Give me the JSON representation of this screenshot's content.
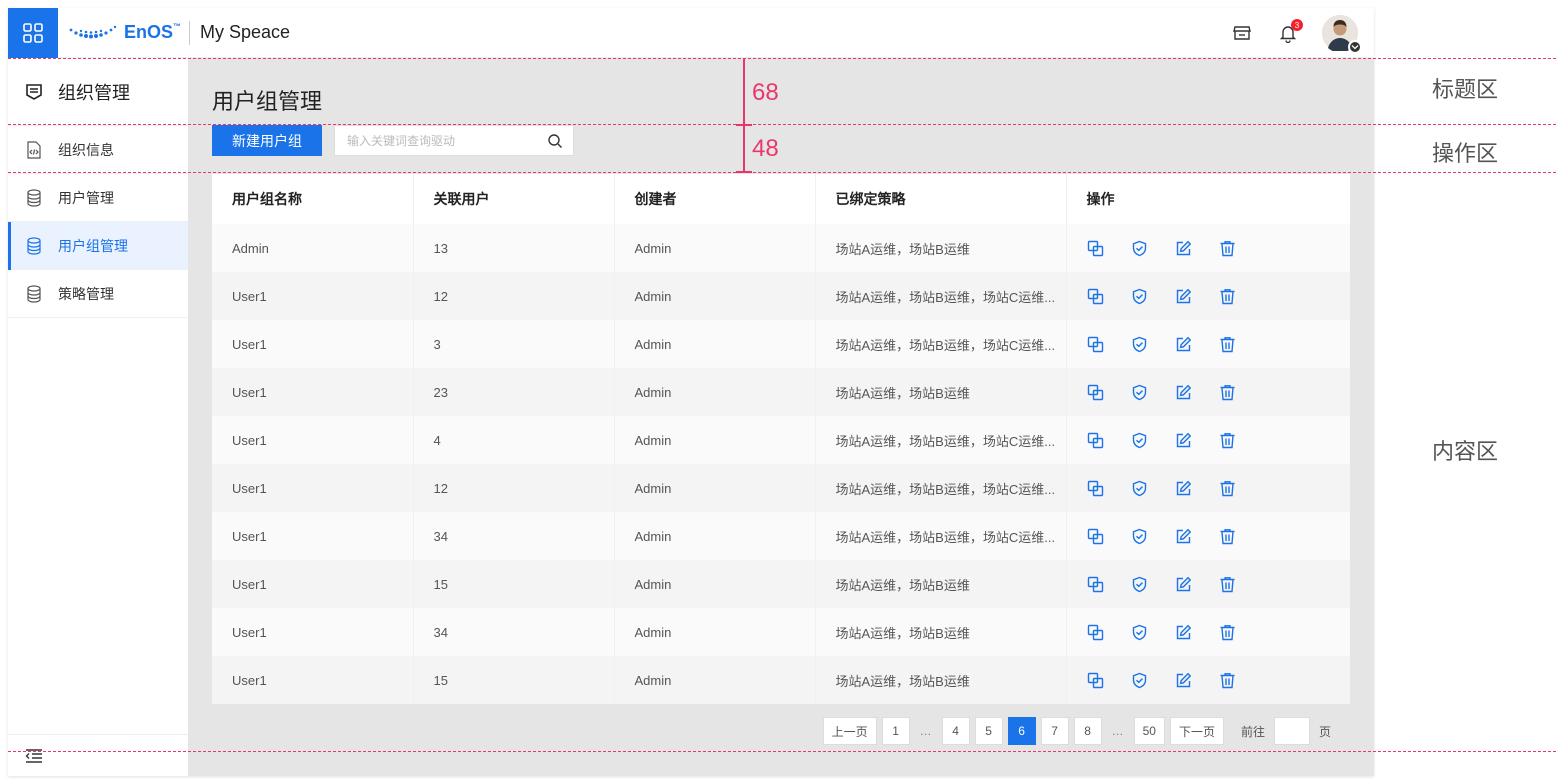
{
  "topbar": {
    "brand": "EnOS",
    "brand_tm": "™",
    "workspace": "My Speace",
    "notification_count": "3"
  },
  "sidebar": {
    "title": "组织管理",
    "items": [
      {
        "label": "组织信息",
        "icon": "document-code-icon",
        "active": false
      },
      {
        "label": "用户管理",
        "icon": "database-icon",
        "active": false
      },
      {
        "label": "用户组管理",
        "icon": "database-icon",
        "active": true
      },
      {
        "label": "策略管理",
        "icon": "database-icon",
        "active": false
      }
    ]
  },
  "main": {
    "page_title": "用户组管理",
    "new_button": "新建用户组",
    "search_placeholder": "输入关键词查询驱动"
  },
  "table": {
    "columns": [
      "用户组名称",
      "关联用户",
      "创建者",
      "已绑定策略",
      "操作"
    ],
    "rows": [
      {
        "name": "Admin",
        "users": "13",
        "creator": "Admin",
        "policy": "场站A运维，场站B运维"
      },
      {
        "name": "User1",
        "users": "12",
        "creator": "Admin",
        "policy": "场站A运维，场站B运维，场站C运维..."
      },
      {
        "name": "User1",
        "users": "3",
        "creator": "Admin",
        "policy": "场站A运维，场站B运维，场站C运维..."
      },
      {
        "name": "User1",
        "users": "23",
        "creator": "Admin",
        "policy": "场站A运维，场站B运维"
      },
      {
        "name": "User1",
        "users": "4",
        "creator": "Admin",
        "policy": "场站A运维，场站B运维，场站C运维..."
      },
      {
        "name": "User1",
        "users": "12",
        "creator": "Admin",
        "policy": "场站A运维，场站B运维，场站C运维..."
      },
      {
        "name": "User1",
        "users": "34",
        "creator": "Admin",
        "policy": "场站A运维，场站B运维，场站C运维..."
      },
      {
        "name": "User1",
        "users": "15",
        "creator": "Admin",
        "policy": "场站A运维，场站B运维"
      },
      {
        "name": "User1",
        "users": "34",
        "creator": "Admin",
        "policy": "场站A运维，场站B运维"
      },
      {
        "name": "User1",
        "users": "15",
        "creator": "Admin",
        "policy": "场站A运维，场站B运维"
      }
    ],
    "row_actions": [
      "copy-icon",
      "shield-check-icon",
      "edit-icon",
      "delete-icon"
    ]
  },
  "pagination": {
    "prev": "上一页",
    "next": "下一页",
    "pages": [
      "1",
      "…",
      "4",
      "5",
      "6",
      "7",
      "8",
      "…",
      "50"
    ],
    "current": "6",
    "goto_label": "前往",
    "goto_suffix": "页"
  },
  "annotations": {
    "title_height": "68",
    "action_height": "48",
    "zone_title": "标题区",
    "zone_action": "操作区",
    "zone_content": "内容区"
  },
  "colors": {
    "primary": "#1a73e8",
    "annotation": "#e8386b"
  }
}
